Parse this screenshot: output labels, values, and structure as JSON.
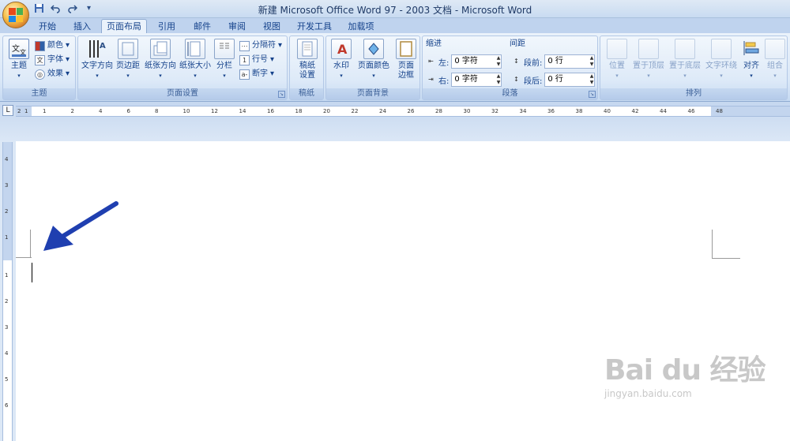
{
  "titlebar": {
    "title": "新建 Microsoft Office Word 97 - 2003 文档 - Microsoft Word",
    "qat_icons": [
      "save-icon",
      "undo-icon",
      "redo-icon",
      "customize-qat-icon"
    ]
  },
  "tabs": [
    {
      "label": "开始"
    },
    {
      "label": "插入"
    },
    {
      "label": "页面布局",
      "active": true
    },
    {
      "label": "引用"
    },
    {
      "label": "邮件"
    },
    {
      "label": "审阅"
    },
    {
      "label": "视图"
    },
    {
      "label": "开发工具"
    },
    {
      "label": "加载项"
    }
  ],
  "ribbon": {
    "themes": {
      "group_label": "主题",
      "theme_button": "主题",
      "colors": "颜色",
      "fonts": "字体",
      "effects": "效果"
    },
    "page_setup": {
      "group_label": "页面设置",
      "text_direction": "文字方向",
      "margins": "页边距",
      "orientation": "纸张方向",
      "size": "纸张大小",
      "columns": "分栏",
      "breaks": "分隔符",
      "line_numbers": "行号",
      "hyphenation": "断字"
    },
    "manuscript": {
      "group_label": "稿纸",
      "button_line1": "稿纸",
      "button_line2": "设置"
    },
    "page_background": {
      "group_label": "页面背景",
      "watermark": "水印",
      "page_color": "页面颜色",
      "borders_line1": "页面",
      "borders_line2": "边框"
    },
    "paragraph": {
      "group_label": "段落",
      "indent_header": "缩进",
      "spacing_header": "间距",
      "left_label": "左:",
      "left_value": "0 字符",
      "right_label": "右:",
      "right_value": "0 字符",
      "before_label": "段前:",
      "before_value": "0 行",
      "after_label": "段后:",
      "after_value": "0 行"
    },
    "arrange": {
      "group_label": "排列",
      "position": "位置",
      "bring_front": "置于顶层",
      "send_back": "置于底层",
      "text_wrap": "文字环绕",
      "align": "对齐",
      "group": "组合"
    }
  },
  "ruler": {
    "tab_selector": "L",
    "h_ticks": [
      "2",
      "1",
      "1",
      "2",
      "4",
      "6",
      "8",
      "10",
      "12",
      "14",
      "16",
      "18",
      "20",
      "22",
      "24",
      "26",
      "28",
      "30",
      "32",
      "34",
      "36",
      "38",
      "40",
      "42",
      "44",
      "46",
      "48"
    ],
    "v_ticks": [
      "4",
      "3",
      "2",
      "1",
      "1",
      "2",
      "3",
      "4",
      "5",
      "6"
    ]
  },
  "watermark": {
    "logo": "Bai du 经验",
    "url": "jingyan.baidu.com"
  },
  "colors": {
    "arrow": "#1f3fb0",
    "ribbon_text": "#15428b"
  }
}
